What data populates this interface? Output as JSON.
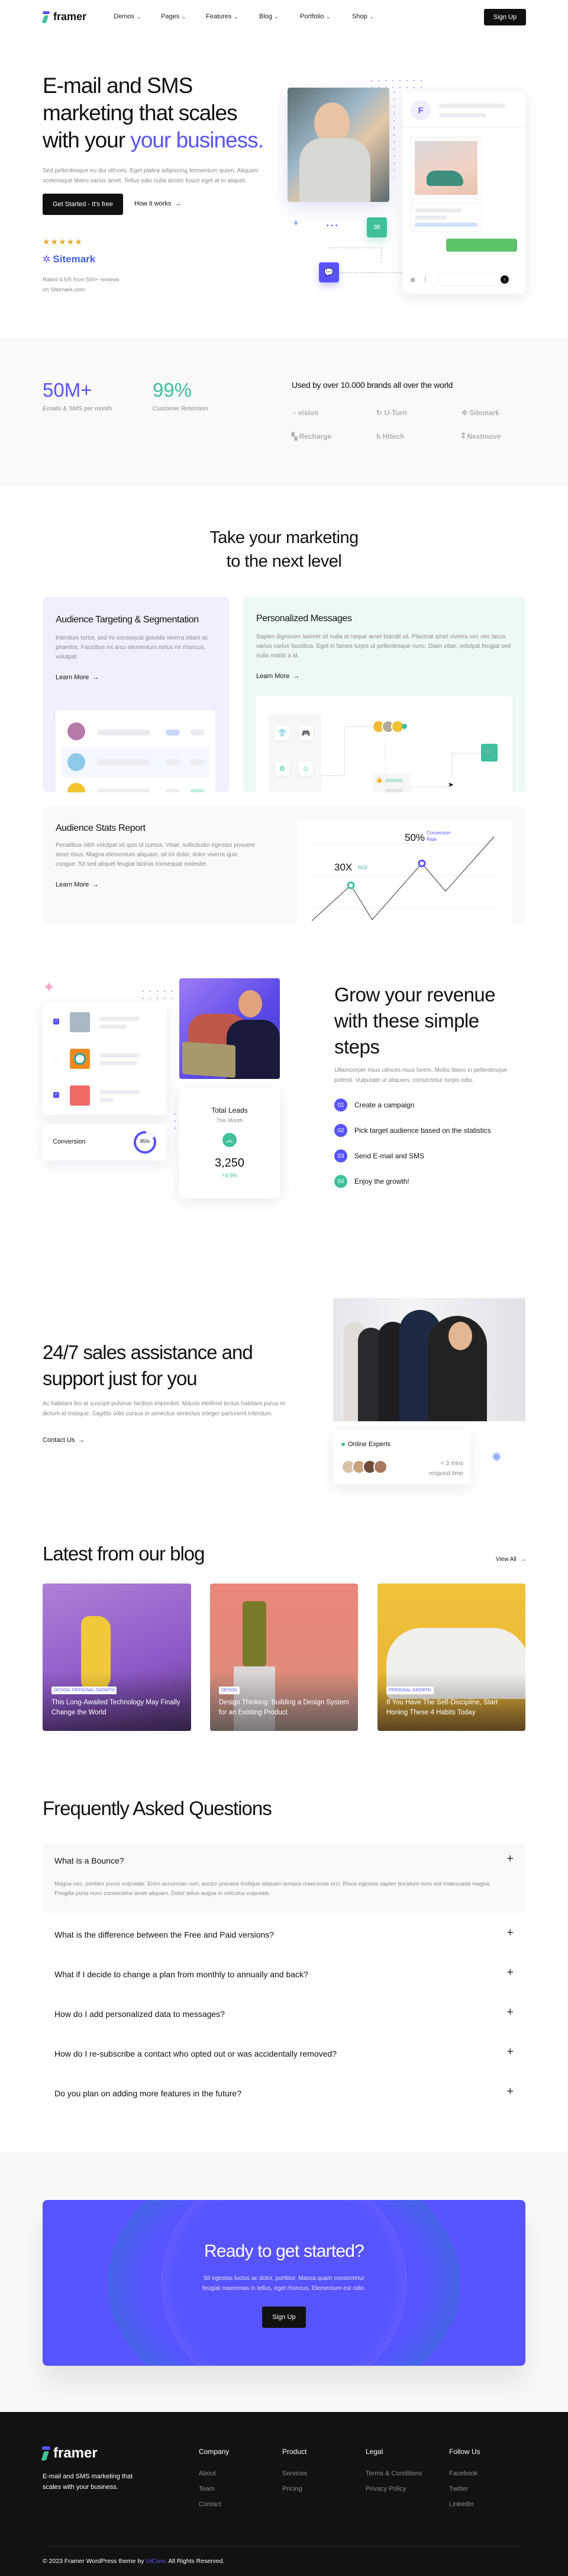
{
  "nav": {
    "brand": "framer",
    "items": [
      {
        "label": "Demos"
      },
      {
        "label": "Pages"
      },
      {
        "label": "Features"
      },
      {
        "label": "Blog"
      },
      {
        "label": "Portfolio"
      },
      {
        "label": "Shop"
      }
    ],
    "signup": "Sign Up"
  },
  "hero": {
    "title_line1": "E-mail and SMS",
    "title_line2": "marketing that scales",
    "title_line3_plain": "with your ",
    "title_line3_accent": "your business.",
    "description": "Sed pellentesque eu dui ultrices. Eget platea adipiscing fermentum quam. Aliquam scelerisque libero varius amet. Tellus odio nulla donec fusce eget at in aliquet.",
    "cta_primary": "Get Started - It's free",
    "cta_secondary": "How it works",
    "rating_stars": 5,
    "review_brand": "Sitemark",
    "rating_text_1": "Rated 4.5/5 from 500+ reviews",
    "rating_text_2": "on Sitemark.com",
    "chat_avatar_letter": "F"
  },
  "stats": {
    "items": [
      {
        "value": "50M+",
        "label": "Emails & SMS per month",
        "color": "#5753ff"
      },
      {
        "value": "99%",
        "label": "Customer Retention",
        "color": "#3fc09b"
      }
    ],
    "brands_title": "Used by over 10.000 brands all over the world",
    "brands": [
      "vision",
      "U-Turn",
      "Sitemark",
      "Recharge",
      "Hitech",
      "Nextmove"
    ]
  },
  "features": {
    "title_line1": "Take your marketing",
    "title_line2": "to the next level",
    "cards": [
      {
        "title": "Audience Targeting & Segmentation",
        "text": "Interdum tortor, sed mi consequat gravida viverra etiam ac pharetra. Faucibus mi arcu elementum netus mi rhoncus, volutpat.",
        "link": "Learn More"
      },
      {
        "title": "Personalized Messages",
        "text": "Sapien dignissim laoreet sit nulla at neque amet blandit sit. Placerat amet viverra nec nec lacus varius varius faucibus. Eget in fames turpis ut pellentesque nunc. Diam vitae, volutpat feugiat sed nulla mattis a id.",
        "link": "Learn More"
      },
      {
        "title": "Audience Stats Report",
        "text": "Penatibus nibh volutpat sit quis id cursus. Vitae, sollicitudin egestas posuere amet risus. Magna elementum aliquam, sit mi dolor, dolor viverra quis congue. Sit sed aliquet feugiat lacinia consequat molestie.",
        "link": "Learn More"
      }
    ],
    "chart": {
      "roi_value": "30X",
      "roi_label": "ROI",
      "conv_value": "50%",
      "conv_label_1": "Conversion",
      "conv_label_2": "Rate"
    }
  },
  "grow": {
    "title_line1": "Grow your revenue",
    "title_line2": "with these simple",
    "title_line3": "steps",
    "description": "Ullamcorper risus ultrices risus lorem. Mollis libero in pellentesque potenti. Vulputate ut aliquam, consectetur turpis odio.",
    "steps": [
      {
        "num": "01",
        "label": "Create a campaign",
        "color": "#5753ff"
      },
      {
        "num": "02",
        "label": "Pick target audience based on the statistics",
        "color": "#5753ff"
      },
      {
        "num": "03",
        "label": "Send E-mail and SMS",
        "color": "#5753ff"
      },
      {
        "num": "04",
        "label": "Enjoy the growth!",
        "color": "#3fc09b"
      }
    ],
    "checklist_checked": [
      true,
      false,
      true
    ],
    "conversion_label": "Conversion",
    "conversion_value": "85%",
    "conversion_percent": 85,
    "leads_title": "Total Leads",
    "leads_period": "This Month",
    "leads_value": "3,250",
    "leads_change": "+4.5%"
  },
  "support": {
    "title_line1": "24/7 sales assistance and",
    "title_line2": "support just for you",
    "description": "Ac habitant leo at suscipit pulvinar facilisis imperdiet. Mauris eleifend lectus habitant purus et dictum id tristique. Sagittis odio cursus in senectus senectus integer parturient interdum.",
    "link": "Contact Us",
    "online_label": "Online Experts",
    "respond_1": "< 3 mins",
    "respond_2": "respond time"
  },
  "blog": {
    "title": "Latest from our blog",
    "view_all": "View All",
    "posts": [
      {
        "tag": "DESIGN, PERSONAL GROWTH",
        "title": "This Long-Awaited Technology May Finally Change the World"
      },
      {
        "tag": "DESIGN",
        "title": "Design Thinking: Building a Design System for an Existing Product"
      },
      {
        "tag": "PERSONAL GROWTH",
        "title": "If You Have The Self-Discipline, Start Honing These 4 Habits Today"
      }
    ]
  },
  "faq": {
    "title": "Frequently Asked Questions",
    "items": [
      {
        "q": "What is a Bounce?",
        "a": "Magna nec, porttitor purus vulputate. Enim accumsan non, auctor posuere tristique aliquam tempus maecenas orci. Risus egestas sapien tincidunt nunc est malesuada magna. Fringilla porta nunc consectetur amet aliquam. Dolor tellus augue in ridiculus vulputate."
      },
      {
        "q": "What is the difference between the Free and Paid versions?"
      },
      {
        "q": "What if I decide to change a plan from monthly to annually and back?"
      },
      {
        "q": "How do I add personalized data to messages?"
      },
      {
        "q": "How do I re-subscribe a contact who opted out or was accidentally removed?"
      },
      {
        "q": "Do you plan on adding more features in the future?"
      }
    ]
  },
  "cta": {
    "title": "Ready to get started?",
    "text": "Sit egestas luctus ac dolor, porttitor. Massa quam consectetur feugiat maecenas in tellus, eget rhoncus. Elementum est odio.",
    "button": "Sign Up",
    "color": "#5753ff"
  },
  "footer": {
    "brand": "framer",
    "tagline": "E-mail and SMS marketing that scales with your business.",
    "columns": [
      {
        "title": "Company",
        "links": [
          "About",
          "Team",
          "Contact"
        ]
      },
      {
        "title": "Product",
        "links": [
          "Services",
          "Pricing"
        ]
      },
      {
        "title": "Legal",
        "links": [
          "Terms & Conditions",
          "Privacy Policy"
        ]
      },
      {
        "title": "Follow Us",
        "links": [
          "Facebook",
          "Twitter",
          "LinkedIn"
        ]
      }
    ],
    "copyright_pre": "© 2023 Framer WordPress theme by ",
    "copyright_link": "UiCore",
    "copyright_post": ". All Rights Reserved."
  }
}
